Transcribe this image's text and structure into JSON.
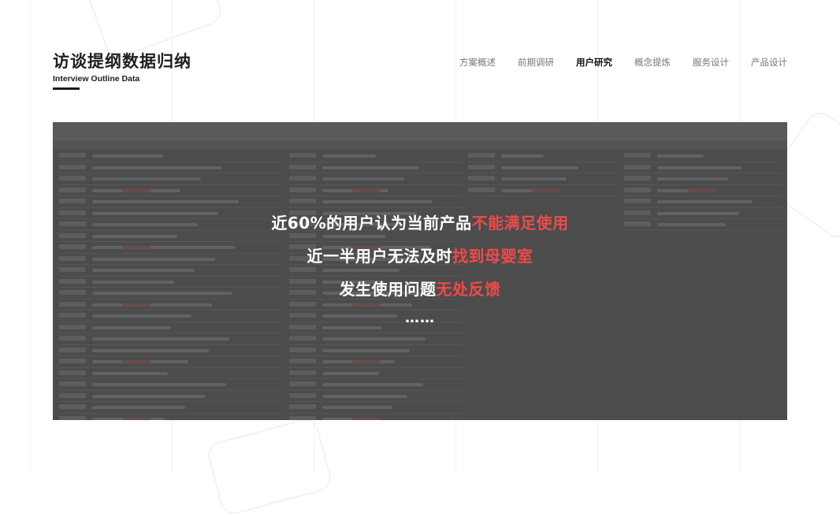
{
  "header": {
    "title": "访谈提纲数据归纳",
    "subtitle": "Interview Outline Data"
  },
  "nav": {
    "items": [
      {
        "label": "方案概述"
      },
      {
        "label": "前期调研"
      },
      {
        "label": "用户研究"
      },
      {
        "label": "概念提炼"
      },
      {
        "label": "服务设计"
      },
      {
        "label": "产品设计"
      }
    ],
    "active_index": 2
  },
  "panel": {
    "lines": [
      {
        "prefix": "近60%的用户认为当前产品",
        "highlight": "不能满足使用"
      },
      {
        "prefix": "近一半用户无法及时",
        "highlight": "找到母婴室"
      },
      {
        "prefix": "发生使用问题",
        "highlight": "无处反馈"
      }
    ],
    "ellipsis": "……",
    "highlight_color": "#ef4a4a"
  }
}
